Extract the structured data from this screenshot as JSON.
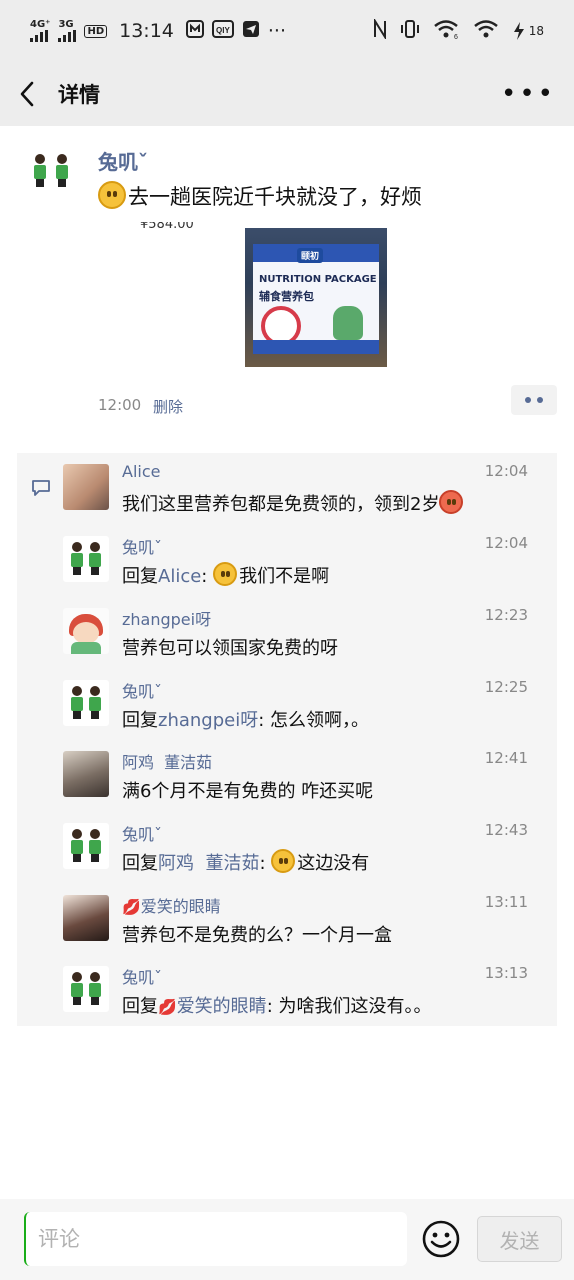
{
  "status_bar": {
    "net1": "4G⁺",
    "net2": "3G",
    "hd": "HD",
    "time": "13:14",
    "more": "···",
    "battery": "18",
    "icons": [
      "nfc-icon",
      "vibrate-icon",
      "wifi-6-icon",
      "wifi-icon",
      "battery-icon"
    ]
  },
  "nav": {
    "title": "详情",
    "more_label": "•••"
  },
  "post": {
    "author": "兔叽ˇ",
    "text": "去一趟医院近千块就没了，好烦",
    "cutoff": "¥584.00",
    "image": {
      "brand": "颐初",
      "title": "NUTRITION PACKAGE",
      "subtitle": "辅食营养包"
    },
    "time": "12:00",
    "delete_label": "删除"
  },
  "comments": [
    {
      "name": "Alice",
      "time": "12:04",
      "reply_to": "",
      "text": "我们这里营养包都是免费领的，领到2岁",
      "avatar": "alice",
      "end_emoji": "red-face"
    },
    {
      "name": "兔叽ˇ",
      "time": "12:04",
      "reply_to": "Alice",
      "text": "我们不是啊",
      "avatar": "kids",
      "start_emoji": "flushed"
    },
    {
      "name": "zhangpei呀",
      "time": "12:23",
      "reply_to": "",
      "text": "营养包可以领国家免费的呀",
      "avatar": "zhang"
    },
    {
      "name": "兔叽ˇ",
      "time": "12:25",
      "reply_to": "zhangpei呀",
      "text": "怎么领啊，。",
      "avatar": "kids"
    },
    {
      "name": "阿鸡  董洁茹",
      "time": "12:41",
      "reply_to": "",
      "text": "满6个月不是有免费的 咋还买呢",
      "avatar": "ji"
    },
    {
      "name": "兔叽ˇ",
      "time": "12:43",
      "reply_to": "阿鸡  董洁茹",
      "text": "这边没有",
      "avatar": "kids",
      "start_emoji": "crying"
    },
    {
      "name": "爱笑的眼睛",
      "time": "13:11",
      "reply_to": "",
      "text": "营养包不是免费的么？一个月一盒",
      "avatar": "aixiao",
      "lips": true
    },
    {
      "name": "兔叽ˇ",
      "time": "13:13",
      "reply_to": "爱笑的眼睛",
      "text": "为啥我们这没有。。",
      "avatar": "kids",
      "reply_lips": true
    }
  ],
  "reply_prefix": "回复",
  "colon": ": ",
  "lips_glyph": "💋",
  "input": {
    "placeholder": "评论",
    "value": ""
  },
  "send_label": "发送",
  "colors": {
    "link": "#576b95",
    "header_bg": "#ededed",
    "comment_bg": "#f5f5f5"
  }
}
